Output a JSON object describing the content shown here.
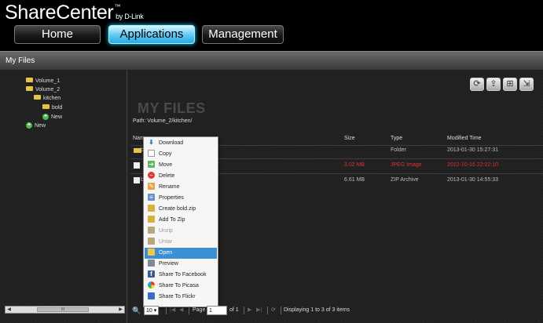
{
  "header": {
    "brand": "ShareCenter",
    "brand_tm": "™",
    "brand_by": "by D-Link"
  },
  "nav": {
    "items": [
      {
        "label": "Home"
      },
      {
        "label": "Applications"
      },
      {
        "label": "Management"
      }
    ],
    "active": "Applications"
  },
  "panel": {
    "title": "My Files"
  },
  "tree": {
    "items": [
      {
        "label": "Volume_1",
        "icon": "folder-icon"
      },
      {
        "label": "Volume_2",
        "icon": "folder-icon"
      },
      {
        "label": "kitchen",
        "icon": "folder-icon"
      },
      {
        "label": "bold",
        "icon": "folder-icon"
      },
      {
        "label": "New",
        "icon": "add-icon"
      },
      {
        "label": "New",
        "icon": "add-icon"
      }
    ],
    "scroll_thumb": "III"
  },
  "content": {
    "title": "MY FILES",
    "path": "Path:  Volume_2/kitchen/",
    "columns": {
      "name": "Nam",
      "size": "Size",
      "type": "Type",
      "modified": "Modified Time"
    },
    "rows": [
      {
        "name": "b",
        "size": "",
        "type": "Folder",
        "modified": "2013-01-30 15:27:31",
        "highlight": false
      },
      {
        "name": "",
        "size": "3.02 MB",
        "type": "JPEG Image",
        "modified": "2012-10-16 22:02:10",
        "highlight": true
      },
      {
        "name": "b",
        "size": "6.61 MB",
        "type": "ZIP Archive",
        "modified": "2013-01-30 14:55:33",
        "highlight": false
      }
    ]
  },
  "context_menu": {
    "items": [
      {
        "label": "Download",
        "icon": "download-icon",
        "enabled": true
      },
      {
        "label": "Copy",
        "icon": "copy-icon",
        "enabled": true
      },
      {
        "label": "Move",
        "icon": "move-icon",
        "enabled": true
      },
      {
        "label": "Delete",
        "icon": "delete-icon",
        "enabled": true
      },
      {
        "label": "Rename",
        "icon": "rename-icon",
        "enabled": true
      },
      {
        "label": "Properties",
        "icon": "properties-icon",
        "enabled": true
      },
      {
        "label": "Create  bold.zip",
        "icon": "create-zip-icon",
        "enabled": true
      },
      {
        "label": "Add To Zip",
        "icon": "add-to-zip-icon",
        "enabled": true
      },
      {
        "label": "Unzip",
        "icon": "unzip-icon",
        "enabled": false
      },
      {
        "label": "Untar",
        "icon": "untar-icon",
        "enabled": false
      },
      {
        "label": "Open",
        "icon": "open-folder-icon",
        "enabled": true,
        "highlighted": true
      },
      {
        "label": "Preview",
        "icon": "preview-icon",
        "enabled": true
      },
      {
        "label": "Share To Facebook",
        "icon": "facebook-icon",
        "enabled": true
      },
      {
        "label": "Share To Picasa",
        "icon": "picasa-icon",
        "enabled": true
      },
      {
        "label": "Share To Flickr",
        "icon": "flickr-icon",
        "enabled": true
      }
    ]
  },
  "pager": {
    "page_size": "10",
    "page_label": "Page",
    "page_value": "1",
    "of_label": "of 1",
    "status": "Displaying 1 to 3 of 3 items"
  },
  "colors": {
    "accent": "#3fb8f0",
    "highlight_text": "#e03030",
    "menu_selected": "#3d8fd0"
  }
}
